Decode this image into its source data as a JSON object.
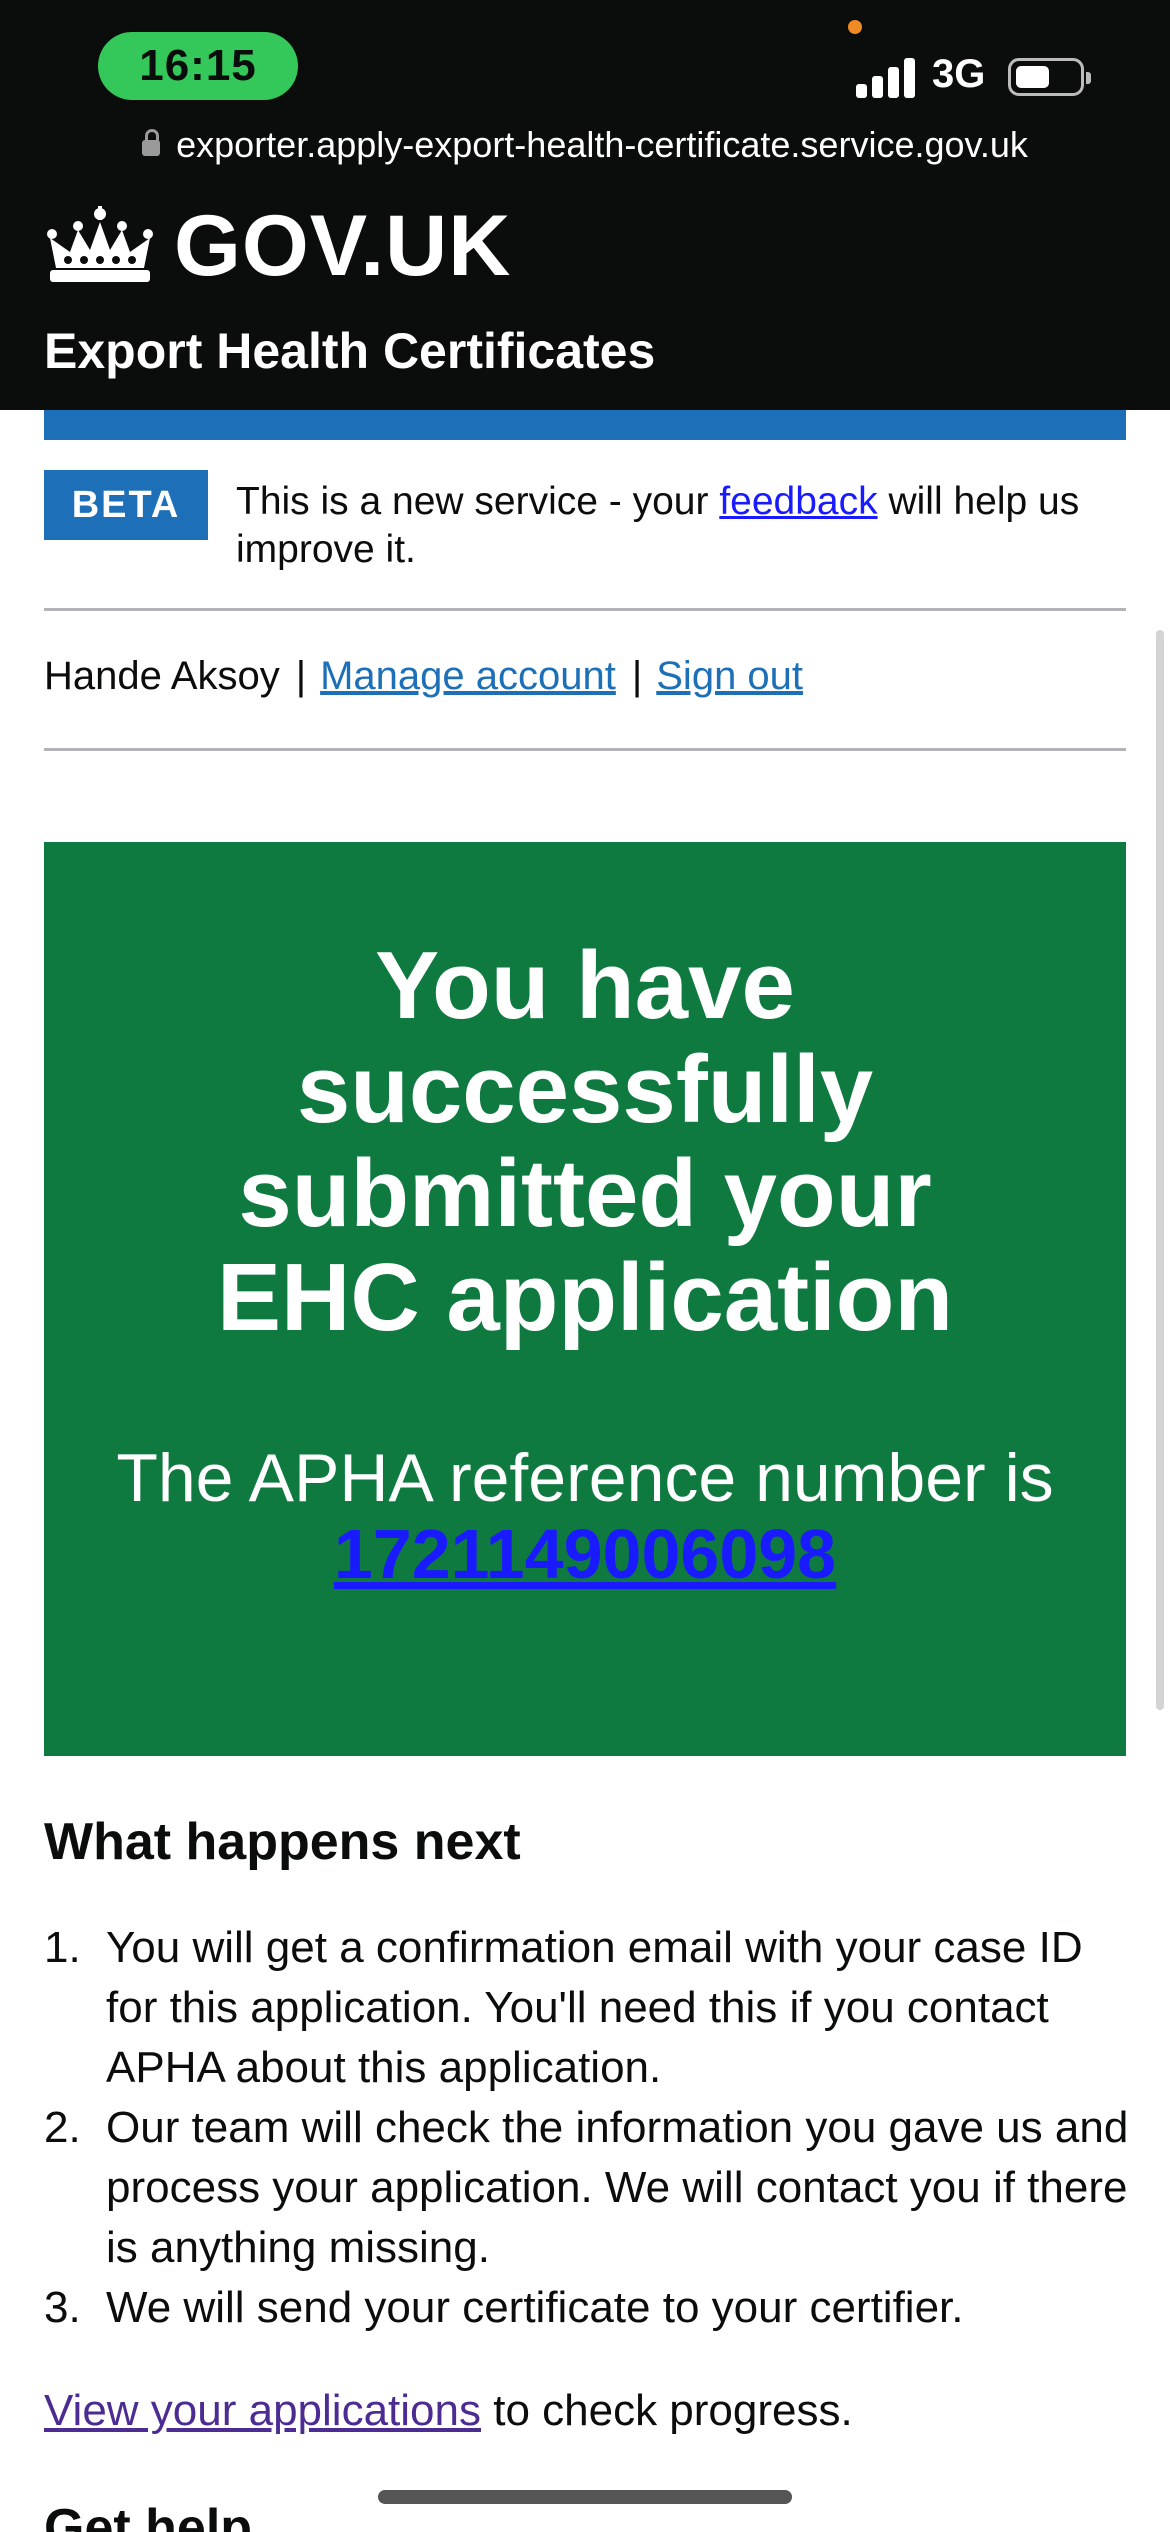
{
  "status_bar": {
    "time": "16:15",
    "network": "3G",
    "battery_level": 0.55
  },
  "browser": {
    "url": "exporter.apply-export-health-certificate.service.gov.uk"
  },
  "header": {
    "logo_text": "GOV.UK",
    "service_name": "Export Health Certificates"
  },
  "phase_banner": {
    "tag": "BETA",
    "text_before": "This is a new service - your ",
    "link": "feedback",
    "text_after": " will help us improve it."
  },
  "account": {
    "user_name": "Hande Aksoy",
    "separator": "|",
    "manage_link": "Manage account",
    "sign_out_link": "Sign out"
  },
  "panel": {
    "title": "You have successfully submitted your EHC application",
    "body": "The APHA reference number is",
    "reference": "1721149006098"
  },
  "next_steps": {
    "heading": "What happens next",
    "items": [
      {
        "num": "1.",
        "text": "You will get a confirmation email with your case ID for this application. You'll need this if you contact APHA about this application."
      },
      {
        "num": "2.",
        "text": "Our team will check the information you gave us and process your application. We will contact you if there is anything missing."
      },
      {
        "num": "3.",
        "text": "We will send your certificate to your certifier."
      }
    ]
  },
  "progress": {
    "link": "View your applications",
    "text": " to check progress."
  },
  "help": {
    "heading": "Get help"
  },
  "colors": {
    "header_bg": "#0b0c0c",
    "brand_blue": "#1d70b8",
    "panel_green": "#0f7a40",
    "time_pill": "#34c759",
    "visited_link": "#4c2c92"
  }
}
